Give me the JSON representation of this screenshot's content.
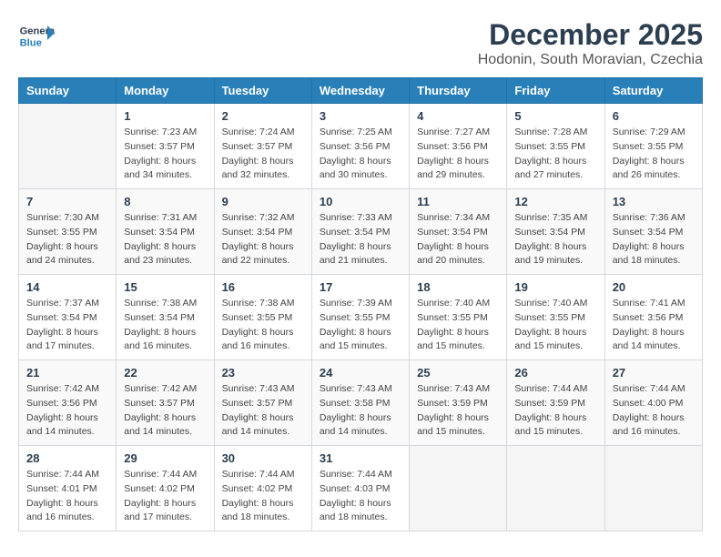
{
  "logo": {
    "general": "General",
    "blue": "Blue"
  },
  "title": "December 2025",
  "subtitle": "Hodonin, South Moravian, Czechia",
  "days_of_week": [
    "Sunday",
    "Monday",
    "Tuesday",
    "Wednesday",
    "Thursday",
    "Friday",
    "Saturday"
  ],
  "weeks": [
    [
      {
        "day": "",
        "info": ""
      },
      {
        "day": "1",
        "info": "Sunrise: 7:23 AM\nSunset: 3:57 PM\nDaylight: 8 hours\nand 34 minutes."
      },
      {
        "day": "2",
        "info": "Sunrise: 7:24 AM\nSunset: 3:57 PM\nDaylight: 8 hours\nand 32 minutes."
      },
      {
        "day": "3",
        "info": "Sunrise: 7:25 AM\nSunset: 3:56 PM\nDaylight: 8 hours\nand 30 minutes."
      },
      {
        "day": "4",
        "info": "Sunrise: 7:27 AM\nSunset: 3:56 PM\nDaylight: 8 hours\nand 29 minutes."
      },
      {
        "day": "5",
        "info": "Sunrise: 7:28 AM\nSunset: 3:55 PM\nDaylight: 8 hours\nand 27 minutes."
      },
      {
        "day": "6",
        "info": "Sunrise: 7:29 AM\nSunset: 3:55 PM\nDaylight: 8 hours\nand 26 minutes."
      }
    ],
    [
      {
        "day": "7",
        "info": "Sunrise: 7:30 AM\nSunset: 3:55 PM\nDaylight: 8 hours\nand 24 minutes."
      },
      {
        "day": "8",
        "info": "Sunrise: 7:31 AM\nSunset: 3:54 PM\nDaylight: 8 hours\nand 23 minutes."
      },
      {
        "day": "9",
        "info": "Sunrise: 7:32 AM\nSunset: 3:54 PM\nDaylight: 8 hours\nand 22 minutes."
      },
      {
        "day": "10",
        "info": "Sunrise: 7:33 AM\nSunset: 3:54 PM\nDaylight: 8 hours\nand 21 minutes."
      },
      {
        "day": "11",
        "info": "Sunrise: 7:34 AM\nSunset: 3:54 PM\nDaylight: 8 hours\nand 20 minutes."
      },
      {
        "day": "12",
        "info": "Sunrise: 7:35 AM\nSunset: 3:54 PM\nDaylight: 8 hours\nand 19 minutes."
      },
      {
        "day": "13",
        "info": "Sunrise: 7:36 AM\nSunset: 3:54 PM\nDaylight: 8 hours\nand 18 minutes."
      }
    ],
    [
      {
        "day": "14",
        "info": "Sunrise: 7:37 AM\nSunset: 3:54 PM\nDaylight: 8 hours\nand 17 minutes."
      },
      {
        "day": "15",
        "info": "Sunrise: 7:38 AM\nSunset: 3:54 PM\nDaylight: 8 hours\nand 16 minutes."
      },
      {
        "day": "16",
        "info": "Sunrise: 7:38 AM\nSunset: 3:55 PM\nDaylight: 8 hours\nand 16 minutes."
      },
      {
        "day": "17",
        "info": "Sunrise: 7:39 AM\nSunset: 3:55 PM\nDaylight: 8 hours\nand 15 minutes."
      },
      {
        "day": "18",
        "info": "Sunrise: 7:40 AM\nSunset: 3:55 PM\nDaylight: 8 hours\nand 15 minutes."
      },
      {
        "day": "19",
        "info": "Sunrise: 7:40 AM\nSunset: 3:55 PM\nDaylight: 8 hours\nand 15 minutes."
      },
      {
        "day": "20",
        "info": "Sunrise: 7:41 AM\nSunset: 3:56 PM\nDaylight: 8 hours\nand 14 minutes."
      }
    ],
    [
      {
        "day": "21",
        "info": "Sunrise: 7:42 AM\nSunset: 3:56 PM\nDaylight: 8 hours\nand 14 minutes."
      },
      {
        "day": "22",
        "info": "Sunrise: 7:42 AM\nSunset: 3:57 PM\nDaylight: 8 hours\nand 14 minutes."
      },
      {
        "day": "23",
        "info": "Sunrise: 7:43 AM\nSunset: 3:57 PM\nDaylight: 8 hours\nand 14 minutes."
      },
      {
        "day": "24",
        "info": "Sunrise: 7:43 AM\nSunset: 3:58 PM\nDaylight: 8 hours\nand 14 minutes."
      },
      {
        "day": "25",
        "info": "Sunrise: 7:43 AM\nSunset: 3:59 PM\nDaylight: 8 hours\nand 15 minutes."
      },
      {
        "day": "26",
        "info": "Sunrise: 7:44 AM\nSunset: 3:59 PM\nDaylight: 8 hours\nand 15 minutes."
      },
      {
        "day": "27",
        "info": "Sunrise: 7:44 AM\nSunset: 4:00 PM\nDaylight: 8 hours\nand 16 minutes."
      }
    ],
    [
      {
        "day": "28",
        "info": "Sunrise: 7:44 AM\nSunset: 4:01 PM\nDaylight: 8 hours\nand 16 minutes."
      },
      {
        "day": "29",
        "info": "Sunrise: 7:44 AM\nSunset: 4:02 PM\nDaylight: 8 hours\nand 17 minutes."
      },
      {
        "day": "30",
        "info": "Sunrise: 7:44 AM\nSunset: 4:02 PM\nDaylight: 8 hours\nand 18 minutes."
      },
      {
        "day": "31",
        "info": "Sunrise: 7:44 AM\nSunset: 4:03 PM\nDaylight: 8 hours\nand 18 minutes."
      },
      {
        "day": "",
        "info": ""
      },
      {
        "day": "",
        "info": ""
      },
      {
        "day": "",
        "info": ""
      }
    ]
  ]
}
